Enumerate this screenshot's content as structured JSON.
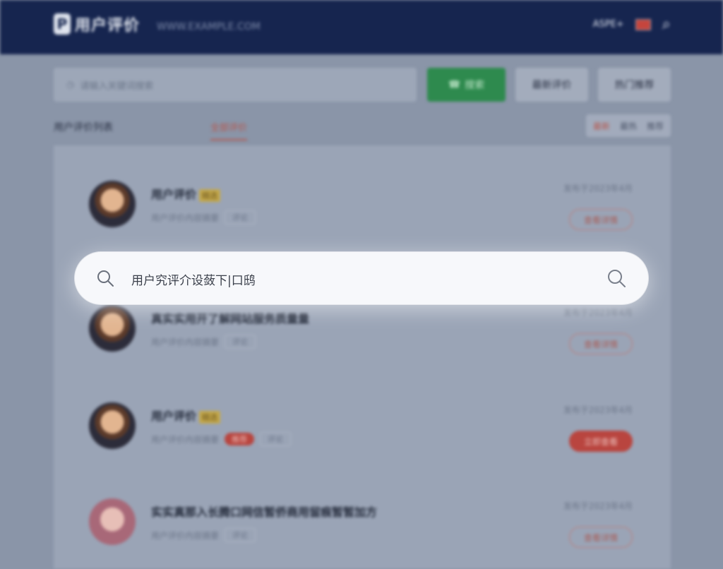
{
  "header": {
    "logo_mark": "P",
    "logo_text": "用户评价",
    "site_url": "WWW.EXAMPLE.COM",
    "lang": "ASPE+",
    "search_icon": "search-icon"
  },
  "toolbar": {
    "search_placeholder": "请输入关键词搜索",
    "search_button": "搜索",
    "button_a": "最新评价",
    "button_b": "热门推荐"
  },
  "tabs": {
    "main": "用户评价列表",
    "active": "全部评价",
    "sort": [
      "最新",
      "最热",
      "推荐"
    ]
  },
  "list": {
    "items": [
      {
        "title": "用户评价",
        "tag": "精选",
        "meta": "用户评价内容摘要",
        "chip": "评论",
        "date": "发布于2023年4月",
        "button": "查看详情",
        "filled": false,
        "avatar": "male"
      },
      {
        "title": "真实实用开了解网站服务质量量",
        "tag": "",
        "meta": "用户评价内容摘要",
        "chip": "评论",
        "date": "发布于2023年4月",
        "button": "查看详情",
        "filled": false,
        "avatar": "male"
      },
      {
        "title": "用户评价",
        "tag": "精选",
        "meta": "用户评价内容摘要",
        "chip": "评论",
        "red": "推荐",
        "date": "发布于2023年4月",
        "button": "立即查看",
        "filled": true,
        "avatar": "male"
      },
      {
        "title": "实实真那入长腾口网信暂侨商用留痕暂暂加方",
        "tag": "",
        "meta": "用户评价内容摘要",
        "chip": "评论",
        "date": "发布于2023年4月",
        "button": "查看详情",
        "filled": false,
        "avatar": "female"
      }
    ]
  },
  "overlay": {
    "search_value": "用户究评介设蔹下|口鸱",
    "left_icon": "search-icon",
    "right_icon": "search-icon"
  },
  "colors": {
    "topbar": "#16254f",
    "accent_green": "#2e8a4e",
    "accent_red": "#b9453f",
    "overlay_dim": "#8a95a8"
  }
}
